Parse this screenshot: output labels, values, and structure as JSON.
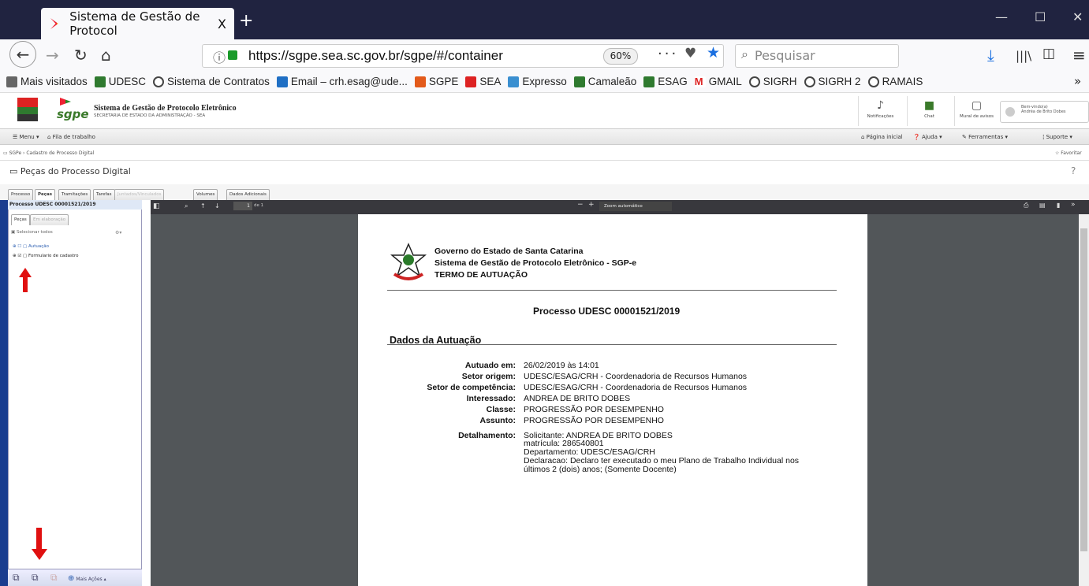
{
  "browser": {
    "tab_title": "Sistema de Gestão de Protocol",
    "tab_close": "X",
    "new_tab": "+",
    "url": "https://sgpe.sea.sc.gov.br/sgpe/#/container",
    "zoom": "60%",
    "search_placeholder": "Pesquisar",
    "page_actions": "···",
    "min": "—",
    "max": "☐",
    "close": "✕"
  },
  "bookmarks": [
    {
      "label": "Mais visitados",
      "color": "#666"
    },
    {
      "label": "UDESC",
      "color": "#2f7a2f"
    },
    {
      "label": "Sistema de Contratos",
      "color": "#444"
    },
    {
      "label": "Email – crh.esag@ude...",
      "color": "#1f6fc4"
    },
    {
      "label": "SGPE",
      "color": "#e35a1a"
    },
    {
      "label": "SEA",
      "color": "#d22"
    },
    {
      "label": "Expresso",
      "color": "#3a8fd0"
    },
    {
      "label": "Camaleão",
      "color": "#2f7a2f"
    },
    {
      "label": "ESAG",
      "color": "#2f7a2f"
    },
    {
      "label": "GMAIL",
      "color": "#d22"
    },
    {
      "label": "SIGRH",
      "color": "#444"
    },
    {
      "label": "SIGRH 2",
      "color": "#444"
    },
    {
      "label": "RAMAIS",
      "color": "#444"
    }
  ],
  "app": {
    "brand": "sgpe",
    "title": "Sistema de Gestão de Protocolo Eletrônico",
    "subtitle": "SECRETARIA DE ESTADO DA ADMINISTRAÇÃO - SEA",
    "notificacoes": "Notificações",
    "chat": "Chat",
    "mural": "Mural de avisos",
    "welcome": "Bem-vindo(a)",
    "user": "Andréa de Brito Dobes"
  },
  "menubar": {
    "menu": "Menu",
    "fila": "Fila de trabalho",
    "inicial": "Página inicial",
    "ajuda": "Ajuda",
    "ferramentas": "Ferramentas",
    "suporte": "Suporte"
  },
  "breadcrumb": {
    "root": "SGPe",
    "current": "Cadastro de Processo Digital",
    "fav": "Favoritar"
  },
  "page_title": "Peças do Processo Digital",
  "tabs": [
    "Processo",
    "Peças",
    "Tramitações",
    "Tarefas",
    "Juntados/Vinculados",
    "Volumes",
    "Dados Adicionais"
  ],
  "left": {
    "title": "Processo UDESC 00001521/2019",
    "subtab_active": "Peças",
    "subtab_other": "Em elaboração",
    "select_all": "Selecionar todos",
    "items": [
      "Autuação",
      "Formulario de cadastro"
    ],
    "mais_acoes": "Mais Ações"
  },
  "viewer": {
    "page_num": "1",
    "page_of": "de 1",
    "zoom": "Zoom automático"
  },
  "document": {
    "gov": "Governo do Estado de Santa Catarina",
    "system": "Sistema de Gestão de Protocolo Eletrônico - SGP-e",
    "termo": "TERMO DE AUTUAÇÃO",
    "processo": "Processo UDESC 00001521/2019",
    "section": "Dados da Autuação",
    "fields": [
      {
        "label": "Autuado em:",
        "value": "26/02/2019 às 14:01"
      },
      {
        "label": "Setor origem:",
        "value": "UDESC/ESAG/CRH - Coordenadoria de Recursos Humanos"
      },
      {
        "label": "Setor de competência:",
        "value": "UDESC/ESAG/CRH - Coordenadoria de Recursos Humanos"
      },
      {
        "label": "Interessado:",
        "value": "ANDREA DE BRITO DOBES"
      },
      {
        "label": "Classe:",
        "value": "PROGRESSÃO POR DESEMPENHO"
      },
      {
        "label": "Assunto:",
        "value": "PROGRESSÃO POR DESEMPENHO"
      },
      {
        "label": "Detalhamento:",
        "value": "Solicitante: ANDREA DE BRITO DOBES"
      }
    ],
    "detail_lines": [
      "matrícula: 286540801",
      "Departamento: UDESC/ESAG/CRH",
      "Declaracao: Declaro ter executado o meu Plano de Trabalho Individual nos",
      "últimos 2 (dois) anos; (Somente Docente)"
    ]
  }
}
